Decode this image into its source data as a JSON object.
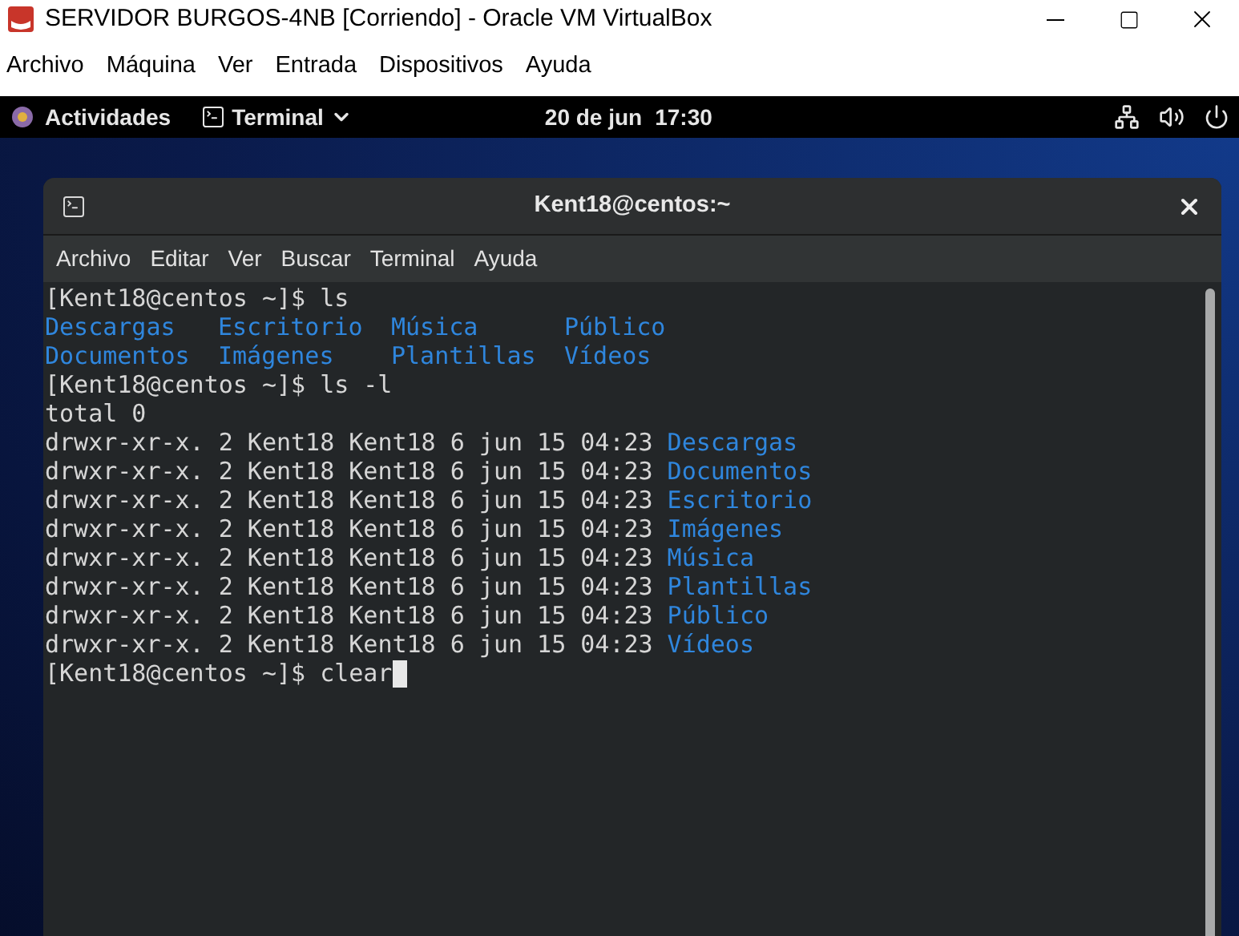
{
  "window": {
    "title": "SERVIDOR BURGOS-4NB [Corriendo] - Oracle VM VirtualBox"
  },
  "menu": [
    "Archivo",
    "Máquina",
    "Ver",
    "Entrada",
    "Dispositivos",
    "Ayuda"
  ],
  "top_bar": {
    "activities": "Actividades",
    "app": "Terminal",
    "date": "20 de jun",
    "time": "17:30"
  },
  "terminal": {
    "title": "Kent18@centos:~",
    "menu": [
      "Archivo",
      "Editar",
      "Ver",
      "Buscar",
      "Terminal",
      "Ayuda"
    ],
    "lines": [
      {
        "kind": "prompt",
        "prompt": "[Kent18@centos ~]$",
        "command": "ls",
        "cursor": false
      },
      {
        "kind": "columns",
        "items": [
          "Descargas",
          "Escritorio",
          "Música",
          "Público"
        ]
      },
      {
        "kind": "columns",
        "items": [
          "Documentos",
          "Imágenes",
          "Plantillas",
          "Vídeos"
        ]
      },
      {
        "kind": "prompt",
        "prompt": "[Kent18@centos ~]$",
        "command": "ls -l",
        "cursor": false
      },
      {
        "kind": "text",
        "text": "total 0"
      },
      {
        "kind": "listing",
        "info": "drwxr-xr-x. 2 Kent18 Kent18 6 jun 15 04:23",
        "name": "Descargas"
      },
      {
        "kind": "listing",
        "info": "drwxr-xr-x. 2 Kent18 Kent18 6 jun 15 04:23",
        "name": "Documentos"
      },
      {
        "kind": "listing",
        "info": "drwxr-xr-x. 2 Kent18 Kent18 6 jun 15 04:23",
        "name": "Escritorio"
      },
      {
        "kind": "listing",
        "info": "drwxr-xr-x. 2 Kent18 Kent18 6 jun 15 04:23",
        "name": "Imágenes"
      },
      {
        "kind": "listing",
        "info": "drwxr-xr-x. 2 Kent18 Kent18 6 jun 15 04:23",
        "name": "Música"
      },
      {
        "kind": "listing",
        "info": "drwxr-xr-x. 2 Kent18 Kent18 6 jun 15 04:23",
        "name": "Plantillas"
      },
      {
        "kind": "listing",
        "info": "drwxr-xr-x. 2 Kent18 Kent18 6 jun 15 04:23",
        "name": "Público"
      },
      {
        "kind": "listing",
        "info": "drwxr-xr-x. 2 Kent18 Kent18 6 jun 15 04:23",
        "name": "Vídeos"
      },
      {
        "kind": "prompt",
        "prompt": "[Kent18@centos ~]$",
        "command": "clear",
        "cursor": true
      }
    ]
  }
}
